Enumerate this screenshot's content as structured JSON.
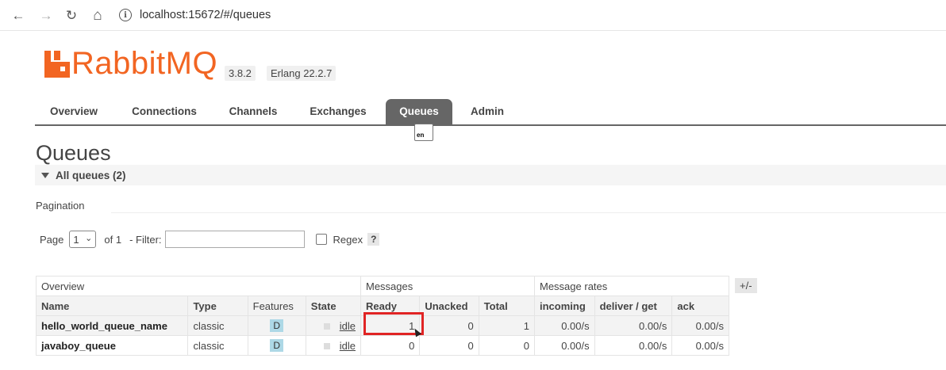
{
  "browser": {
    "url": "localhost:15672/#/queues",
    "back_glyph": "←",
    "forward_glyph": "→",
    "reload_glyph": "↻",
    "home_glyph": "⌂",
    "info_glyph": "i"
  },
  "app": {
    "logo_text": "RabbitMQ",
    "version": "3.8.2",
    "erlang": "Erlang 22.2.7",
    "brand_color": "#f26522"
  },
  "tabs": [
    {
      "label": "Overview"
    },
    {
      "label": "Connections"
    },
    {
      "label": "Channels"
    },
    {
      "label": "Exchanges"
    },
    {
      "label": "Queues"
    },
    {
      "label": "Admin"
    }
  ],
  "lang_icon_text": "en",
  "page": {
    "title": "Queues",
    "section_title": "All queues (2)",
    "pagination_label": "Pagination",
    "page_label": "Page",
    "page_value": "1",
    "page_dropdown_glyph": "⌄",
    "of_label": "of 1",
    "filter_label": "- Filter:",
    "filter_value": "",
    "regex_label": "Regex",
    "help_label": "?"
  },
  "table": {
    "groups": [
      "Overview",
      "Messages",
      "Message rates"
    ],
    "columns": [
      "Name",
      "Type",
      "Features",
      "State",
      "Ready",
      "Unacked",
      "Total",
      "incoming",
      "deliver / get",
      "ack"
    ],
    "rows": [
      {
        "name": "hello_world_queue_name",
        "type": "classic",
        "features": "D",
        "state": "idle",
        "ready": "1",
        "unacked": "0",
        "total": "1",
        "incoming": "0.00/s",
        "deliver_get": "0.00/s",
        "ack": "0.00/s"
      },
      {
        "name": "javaboy_queue",
        "type": "classic",
        "features": "D",
        "state": "idle",
        "ready": "0",
        "unacked": "0",
        "total": "0",
        "incoming": "0.00/s",
        "deliver_get": "0.00/s",
        "ack": "0.00/s"
      }
    ],
    "toggle_label": "+/-"
  }
}
